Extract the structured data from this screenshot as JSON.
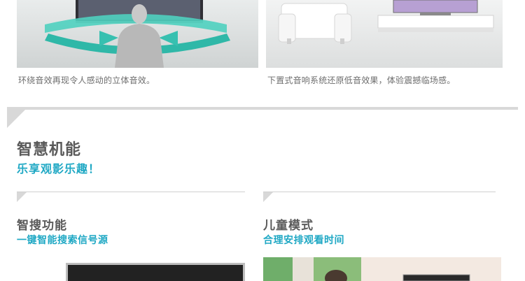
{
  "top_left": {
    "caption": "环绕音效再现令人感动的立体音效。"
  },
  "top_right": {
    "caption": "下置式音响系统还原低音效果，体验震撼临场感。"
  },
  "section": {
    "title": "智慧机能",
    "subtitle": "乐享观影乐趣！"
  },
  "features": [
    {
      "title": "智搜功能",
      "subtitle": "一键智能搜索信号源"
    },
    {
      "title": "儿童模式",
      "subtitle": "合理安排观看时间"
    }
  ],
  "colors": {
    "accent": "#1fa8c4",
    "heading": "#5a5a5a",
    "rule": "#d8d8d8",
    "arrow_teal": "#3fc7b6"
  }
}
